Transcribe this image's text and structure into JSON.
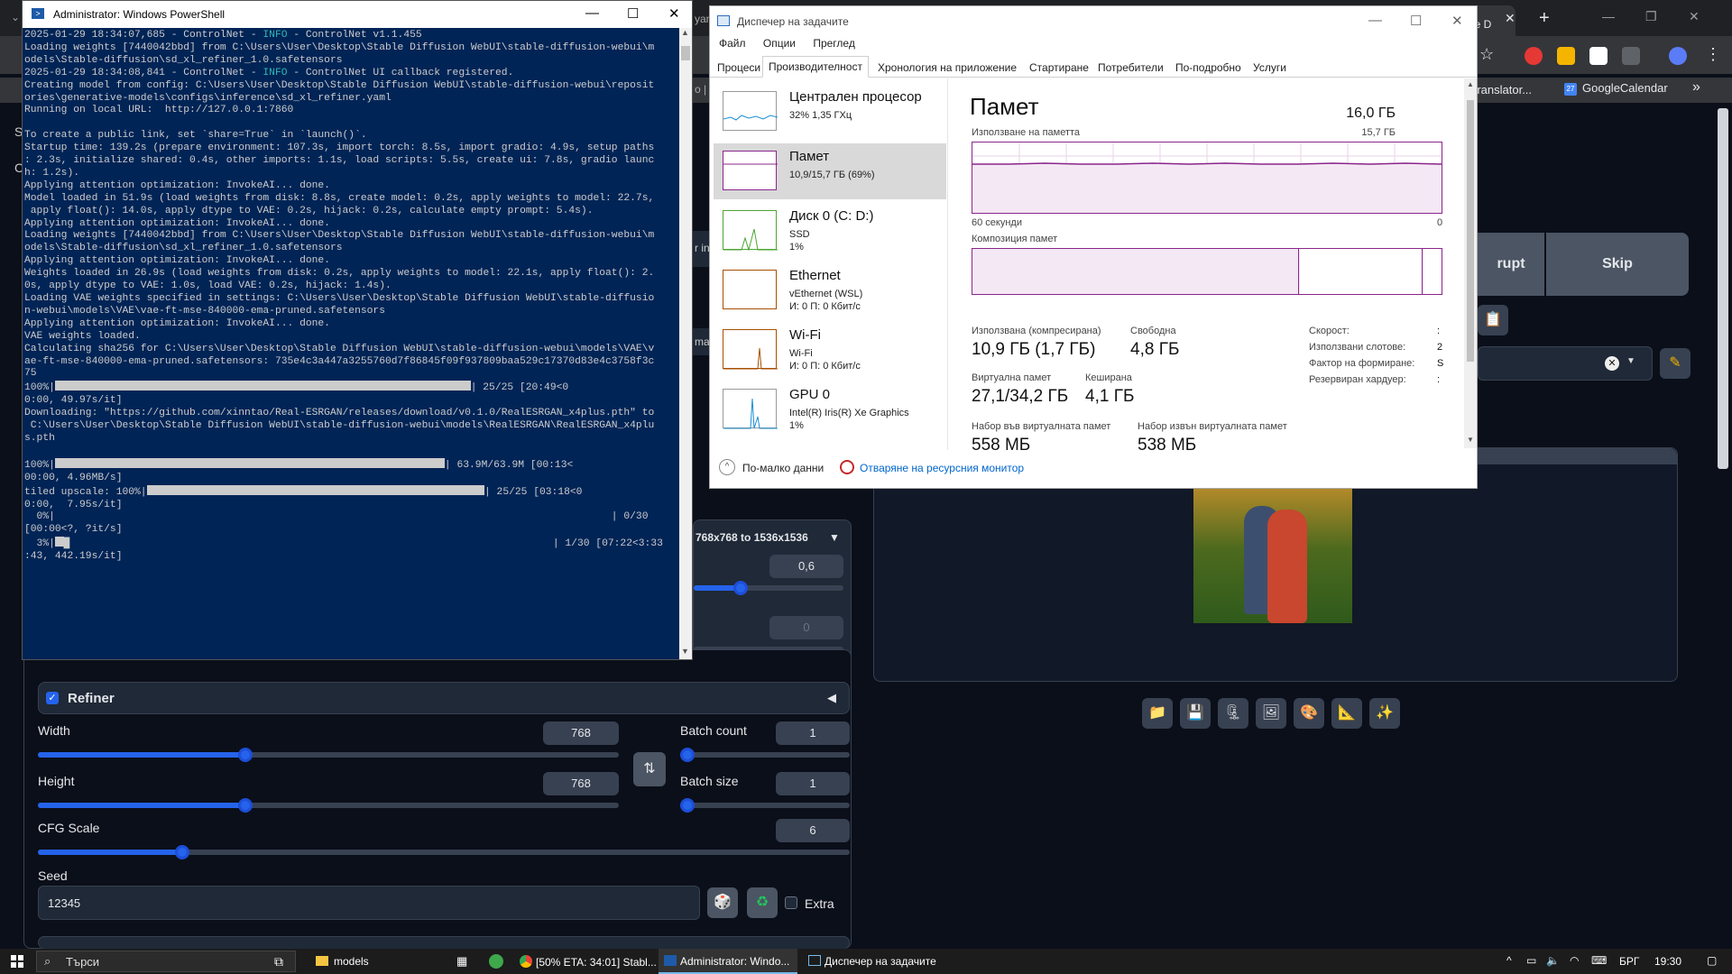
{
  "chrome": {
    "active_tab_text": "le D",
    "bookmarks": {
      "translator": "s Translator...",
      "calendar": "GoogleCalendar",
      "more": "»"
    }
  },
  "webui": {
    "right_buttons": {
      "interrupt_partial": "rupt",
      "skip": "Skip"
    },
    "partial_labels": {
      "yan": "yan",
      "o": "o |",
      "in": "r in",
      "mag": "mag"
    },
    "upscale_label": "768x768  to 1536x1536",
    "denoise_value": "0,6",
    "steps_value": "0",
    "refiner": {
      "label": "Refiner",
      "checked": true
    },
    "width": {
      "label": "Width",
      "value": "768",
      "fraction": 0.36
    },
    "height": {
      "label": "Height",
      "value": "768",
      "fraction": 0.36
    },
    "batch_count": {
      "label": "Batch count",
      "value": "1",
      "fraction": 0.0
    },
    "batch_size": {
      "label": "Batch size",
      "value": "1",
      "fraction": 0.0
    },
    "cfg": {
      "label": "CFG Scale",
      "value": "6",
      "fraction": 0.17
    },
    "seed": {
      "label": "Seed",
      "value": "12345"
    },
    "extra_label": "Extra",
    "partial_s": "S",
    "partial_c": "C"
  },
  "powershell": {
    "title": "Administrator: Windows PowerShell",
    "lines": [
      {
        "pre": "2025-01-29 18:34:07,685 - ControlNet - ",
        "info": "INFO",
        "post": " - ControlNet v1.1.455"
      },
      {
        "text": "Loading weights [7440042bbd] from C:\\Users\\User\\Desktop\\Stable Diffusion WebUI\\stable-diffusion-webui\\m"
      },
      {
        "text": "odels\\Stable-diffusion\\sd_xl_refiner_1.0.safetensors"
      },
      {
        "pre": "2025-01-29 18:34:08,841 - ControlNet - ",
        "info": "INFO",
        "post": " - ControlNet UI callback registered."
      },
      {
        "text": "Creating model from config: C:\\Users\\User\\Desktop\\Stable Diffusion WebUI\\stable-diffusion-webui\\reposit"
      },
      {
        "text": "ories\\generative-models\\configs\\inference\\sd_xl_refiner.yaml"
      },
      {
        "text": "Running on local URL:  http://127.0.0.1:7860"
      },
      {
        "text": ""
      },
      {
        "text": "To create a public link, set `share=True` in `launch()`."
      },
      {
        "text": "Startup time: 139.2s (prepare environment: 107.3s, import torch: 8.5s, import gradio: 4.9s, setup paths"
      },
      {
        "text": ": 2.3s, initialize shared: 0.4s, other imports: 1.1s, load scripts: 5.5s, create ui: 7.8s, gradio launc"
      },
      {
        "text": "h: 1.2s)."
      },
      {
        "text": "Applying attention optimization: InvokeAI... done."
      },
      {
        "text": "Model loaded in 51.9s (load weights from disk: 8.8s, create model: 0.2s, apply weights to model: 22.7s,"
      },
      {
        "text": " apply float(): 14.0s, apply dtype to VAE: 0.2s, hijack: 0.2s, calculate empty prompt: 5.4s)."
      },
      {
        "text": "Applying attention optimization: InvokeAI... done."
      },
      {
        "text": "Loading weights [7440042bbd] from C:\\Users\\User\\Desktop\\Stable Diffusion WebUI\\stable-diffusion-webui\\m"
      },
      {
        "text": "odels\\Stable-diffusion\\sd_xl_refiner_1.0.safetensors"
      },
      {
        "text": "Applying attention optimization: InvokeAI... done."
      },
      {
        "text": "Weights loaded in 26.9s (load weights from disk: 0.2s, apply weights to model: 22.1s, apply float(): 2."
      },
      {
        "text": "0s, apply dtype to VAE: 1.0s, load VAE: 0.2s, hijack: 1.4s)."
      },
      {
        "text": "Loading VAE weights specified in settings: C:\\Users\\User\\Desktop\\Stable Diffusion WebUI\\stable-diffusio"
      },
      {
        "text": "n-webui\\models\\VAE\\vae-ft-mse-840000-ema-pruned.safetensors"
      },
      {
        "text": "Applying attention optimization: InvokeAI... done."
      },
      {
        "text": "VAE weights loaded."
      },
      {
        "text": "Calculating sha256 for C:\\Users\\User\\Desktop\\Stable Diffusion WebUI\\stable-diffusion-webui\\models\\VAE\\v"
      },
      {
        "text": "ae-ft-mse-840000-ema-pruned.safetensors: 735e4c3a447a3255760d7f86845f09f937809baa529c17370d83e4c3758f3c"
      },
      {
        "text": "75"
      },
      {
        "pre": "100%|",
        "bar": 48,
        "post": "| 25/25 [20:49<0"
      },
      {
        "text": "0:00, 49.97s/it]"
      },
      {
        "text": "Downloading: \"https://github.com/xinntao/Real-ESRGAN/releases/download/v0.1.0/RealESRGAN_x4plus.pth\" to"
      },
      {
        "text": " C:\\Users\\User\\Desktop\\Stable Diffusion WebUI\\stable-diffusion-webui\\models\\RealESRGAN\\RealESRGAN_x4plu"
      },
      {
        "text": "s.pth"
      },
      {
        "text": ""
      },
      {
        "pre": "100%|",
        "bar": 45,
        "post": "| 63.9M/63.9M [00:13<"
      },
      {
        "text": "00:00, 4.96MB/s]"
      },
      {
        "pre": "tiled upscale: 100%|",
        "bar": 39,
        "post": "| 25/25 [03:18<0"
      },
      {
        "text": "0:00,  7.95s/it]"
      },
      {
        "text": "  0%|                                                                                           | 0/30"
      },
      {
        "text": "[00:00<?, ?it/s]"
      },
      {
        "pre": "  3%|",
        "bar": 1,
        "post": "█                                                                               | 1/30 [07:22<3:33"
      },
      {
        "text": ":43, 442.19s/it]"
      }
    ]
  },
  "taskmanager": {
    "title": "Диспечер на задачите",
    "menu": [
      "Файл",
      "Опции",
      "Преглед"
    ],
    "tabs": [
      "Процеси",
      "Производителност",
      "Хронология на приложение",
      "Стартиране",
      "Потребители",
      "По-подробно",
      "Услуги"
    ],
    "active_tab": "Производителност",
    "resources": [
      {
        "name": "Централен процесор",
        "sub1": "32%  1,35 ГХц",
        "sub2": "",
        "color": "#1a8ed3"
      },
      {
        "name": "Памет",
        "sub1": "10,9/15,7 ГБ (69%)",
        "sub2": "",
        "color": "#8b258b"
      },
      {
        "name": "Диск 0 (C: D:)",
        "sub1": "SSD",
        "sub2": "1%",
        "color": "#4da533"
      },
      {
        "name": "Ethernet",
        "sub1": "vEthernet (WSL)",
        "sub2": "И: 0 П: 0 Кбит/с",
        "color": "#a74f01"
      },
      {
        "name": "Wi-Fi",
        "sub1": "Wi-Fi",
        "sub2": "И: 0 П: 0 Кбит/с",
        "color": "#a74f01"
      },
      {
        "name": "GPU 0",
        "sub1": "Intel(R) Iris(R) Xe Graphics",
        "sub2": "1%",
        "color": "#1a8ed3"
      }
    ],
    "memory": {
      "title": "Памет",
      "total": "16,0 ГБ",
      "usage_label": "Използване на паметта",
      "usage_max": "15,7 ГБ",
      "graph_x_label": "60 секунди",
      "graph_x_zero": "0",
      "composition_label": "Композиция памет",
      "in_use_label": "Използвана (компресирана)",
      "in_use_value": "10,9 ГБ (1,7 ГБ)",
      "available_label": "Свободна",
      "available_value": "4,8 ГБ",
      "committed_label": "Виртуална памет",
      "committed_value": "27,1/34,2 ГБ",
      "cached_label": "Кеширана",
      "cached_value": "4,1 ГБ",
      "paged_label": "Набор във виртуалната памет",
      "paged_value": "558 МБ",
      "nonpaged_label": "Набор извън виртуалната памет",
      "nonpaged_value": "538 МБ",
      "speed_label": "Скорост:",
      "slots_label": "Използвани слотове:",
      "form_label": "Фактор на формиране:",
      "reserved_label": "Резервиран хардуер:",
      "speed_value": ":",
      "slots_value": "2",
      "form_value": "S",
      "reserved_value": ":"
    },
    "footer_less": "По-малко данни",
    "footer_link": "Отваряне на ресурсния монитор"
  },
  "taskbar": {
    "search_placeholder": "Търси",
    "items": [
      "models",
      "[50% ETA: 34:01] Stabl...",
      "Administrator: Windo...",
      "Диспечер на задачите"
    ],
    "lang": "БРГ",
    "time": "19:30"
  }
}
